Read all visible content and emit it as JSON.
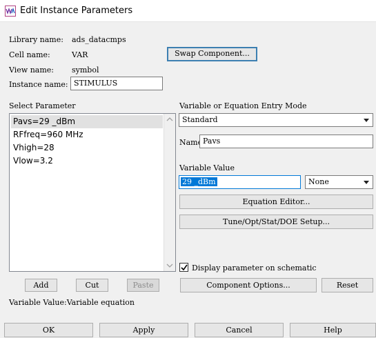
{
  "window": {
    "title": "Edit Instance Parameters",
    "icon": "ads-app-icon"
  },
  "info": {
    "library_label": "Library name:",
    "library_value": "ads_datacmps",
    "cell_label": "Cell name:",
    "cell_value": "VAR",
    "view_label": "View name:",
    "view_value": "symbol",
    "instance_label": "Instance name:",
    "instance_value": "STIMULUS"
  },
  "swap_component_label": "Swap Component...",
  "select_parameter": {
    "label": "Select Parameter",
    "items": [
      "Pavs=29 _dBm",
      "RFfreq=960 MHz",
      "Vhigh=28",
      "Vlow=3.2"
    ],
    "selected_index": 0
  },
  "list_buttons": {
    "add": "Add",
    "cut": "Cut",
    "paste": "Paste"
  },
  "status_text": "Variable Value:Variable equation",
  "entry_mode": {
    "label": "Variable or Equation Entry Mode",
    "value": "Standard"
  },
  "name_field": {
    "label": "Name",
    "value": "Pavs"
  },
  "variable_value": {
    "label": "Variable Value",
    "value": "29 _dBm",
    "unit": "None"
  },
  "equation_editor_label": "Equation Editor...",
  "tune_label": "Tune/Opt/Stat/DOE Setup...",
  "display_param": {
    "label": "Display parameter on schematic",
    "checked": true
  },
  "component_options_label": "Component Options...",
  "reset_label": "Reset",
  "footer": {
    "ok": "OK",
    "apply": "Apply",
    "cancel": "Cancel",
    "help": "Help"
  }
}
